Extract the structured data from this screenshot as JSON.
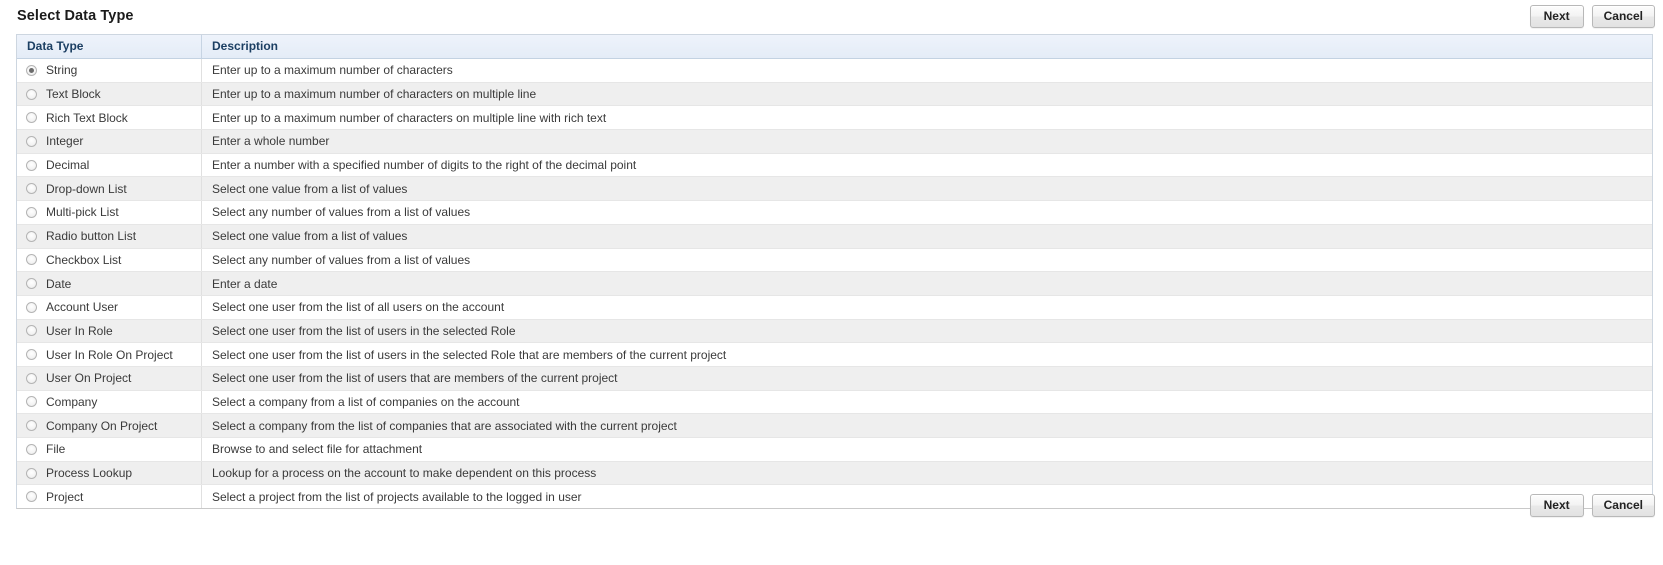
{
  "header": {
    "title": "Select Data Type",
    "next_label": "Next",
    "cancel_label": "Cancel"
  },
  "footer": {
    "next_label": "Next",
    "cancel_label": "Cancel"
  },
  "table": {
    "columns": {
      "type": "Data Type",
      "description": "Description"
    },
    "rows": [
      {
        "type": "String",
        "description": "Enter up to a maximum number of characters",
        "selected": true
      },
      {
        "type": "Text Block",
        "description": "Enter up to a maximum number of characters on multiple line",
        "selected": false
      },
      {
        "type": "Rich Text Block",
        "description": "Enter up to a maximum number of characters on multiple line with rich text",
        "selected": false
      },
      {
        "type": "Integer",
        "description": "Enter a whole number",
        "selected": false
      },
      {
        "type": "Decimal",
        "description": "Enter a number with a specified number of digits to the right of the decimal point",
        "selected": false
      },
      {
        "type": "Drop-down List",
        "description": "Select one value from a list of values",
        "selected": false
      },
      {
        "type": "Multi-pick List",
        "description": "Select any number of values from a list of values",
        "selected": false
      },
      {
        "type": "Radio button List",
        "description": "Select one value from a list of values",
        "selected": false
      },
      {
        "type": "Checkbox List",
        "description": "Select any number of values from a list of values",
        "selected": false
      },
      {
        "type": "Date",
        "description": "Enter a date",
        "selected": false
      },
      {
        "type": "Account User",
        "description": "Select one user from the list of all users on the account",
        "selected": false
      },
      {
        "type": "User In Role",
        "description": "Select one user from the list of users in the selected Role",
        "selected": false
      },
      {
        "type": "User In Role On Project",
        "description": "Select one user from the list of users in the selected Role that are members of the current project",
        "selected": false
      },
      {
        "type": "User On Project",
        "description": "Select one user from the list of users that are members of the current project",
        "selected": false
      },
      {
        "type": "Company",
        "description": "Select a company from a list of companies on the account",
        "selected": false
      },
      {
        "type": "Company On Project",
        "description": "Select a company from the list of companies that are associated with the current project",
        "selected": false
      },
      {
        "type": "File",
        "description": "Browse to and select file for attachment",
        "selected": false
      },
      {
        "type": "Process Lookup",
        "description": "Lookup for a process on the account to make dependent on this process",
        "selected": false
      },
      {
        "type": "Project",
        "description": "Select a project from the list of projects available to the logged in user",
        "selected": false
      }
    ]
  }
}
